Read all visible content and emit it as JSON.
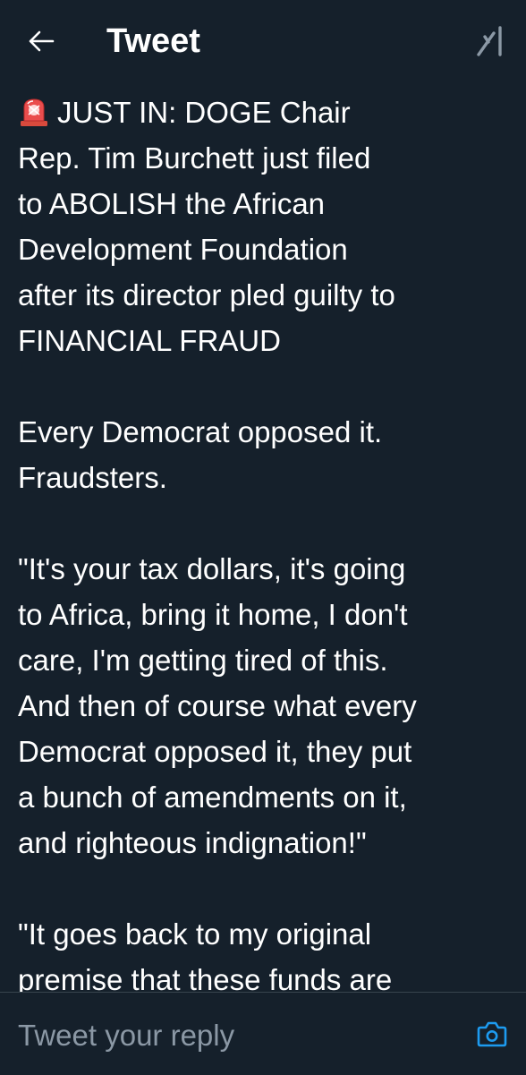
{
  "header": {
    "title": "Tweet",
    "back_icon": "arrow-left-icon",
    "grok_icon": "grok-icon"
  },
  "tweet": {
    "emoji": "police-siren",
    "paragraphs": [
      [
        "JUST IN: DOGE Chair",
        "Rep. Tim Burchett just filed",
        "to ABOLISH the African",
        "Development Foundation",
        "after its director pled guilty to",
        "FINANCIAL FRAUD"
      ],
      [
        "Every Democrat opposed it.",
        "Fraudsters."
      ],
      [
        "\"It's your tax dollars, it's going",
        "to Africa, bring it home, I don't",
        "care, I'm getting tired of this.",
        "And then of course what every",
        "Democrat opposed it, they put",
        "a bunch of amendments on it,",
        "and righteous indignation!\""
      ],
      [
        "\"It goes back to my original",
        "premise that these funds are"
      ]
    ]
  },
  "reply": {
    "placeholder": "Tweet your reply",
    "camera_icon": "camera-icon"
  },
  "colors": {
    "background": "#15202b",
    "text": "#ffffff",
    "muted": "#8b98a5",
    "accent": "#1d9bf0"
  }
}
